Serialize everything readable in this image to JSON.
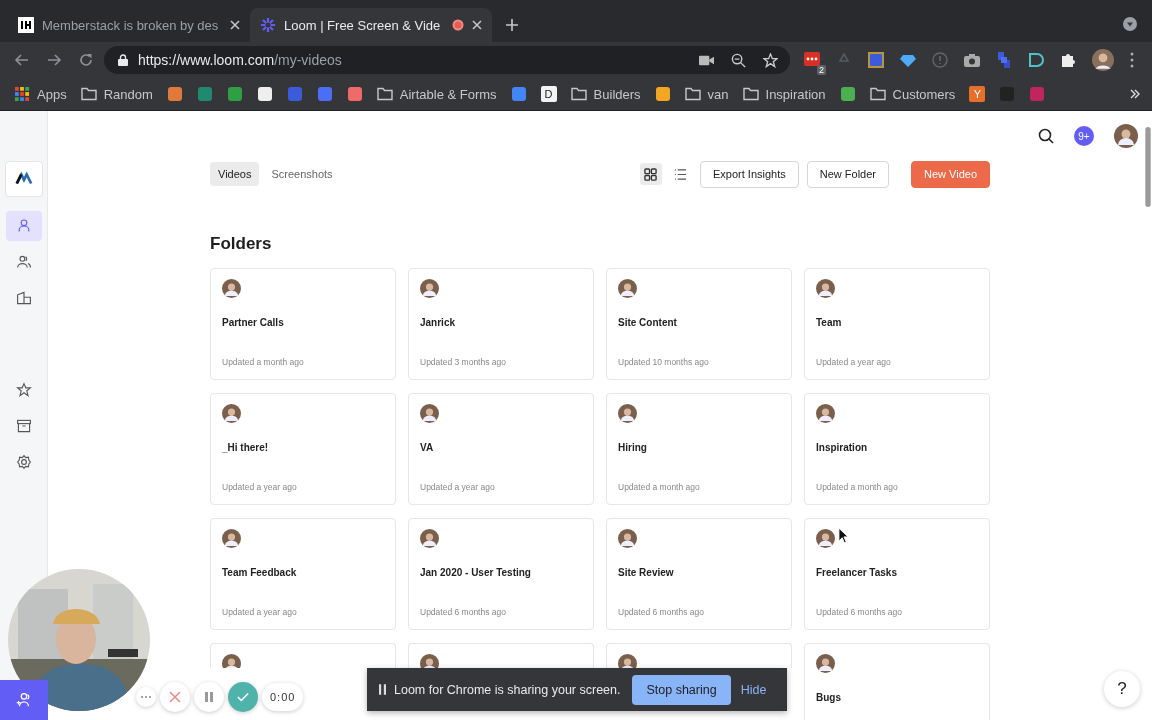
{
  "browser": {
    "tabs": [
      {
        "title": "Memberstack is broken by des",
        "kind": "ih",
        "selected": false,
        "recording": false
      },
      {
        "title": "Loom | Free Screen & Vide",
        "kind": "loom",
        "selected": true,
        "recording": true
      }
    ],
    "url_host": "https://www.loom.com",
    "url_path": "/my-videos",
    "extension_badge": "2",
    "bookmarks": [
      {
        "kind": "apps",
        "label": "Apps"
      },
      {
        "kind": "folder",
        "label": "Random"
      },
      {
        "kind": "icon"
      },
      {
        "kind": "icon"
      },
      {
        "kind": "icon"
      },
      {
        "kind": "icon"
      },
      {
        "kind": "icon"
      },
      {
        "kind": "icon"
      },
      {
        "kind": "icon"
      },
      {
        "kind": "folder",
        "label": "Airtable & Forms"
      },
      {
        "kind": "icon"
      },
      {
        "kind": "letter",
        "label": "D",
        "color": "#f1f3f4"
      },
      {
        "kind": "folder",
        "label": "Builders"
      },
      {
        "kind": "icon"
      },
      {
        "kind": "folder",
        "label": "van"
      },
      {
        "kind": "folder",
        "label": "Inspiration"
      },
      {
        "kind": "icon"
      },
      {
        "kind": "folder",
        "label": "Customers"
      },
      {
        "kind": "letter",
        "label": "Y",
        "color": "#e86f2a"
      },
      {
        "kind": "icon"
      },
      {
        "kind": "icon"
      }
    ]
  },
  "sidebar": {
    "items": [
      {
        "kind": "workspace",
        "selected": false
      },
      {
        "kind": "person",
        "selected": true
      },
      {
        "kind": "people",
        "selected": false
      },
      {
        "kind": "building",
        "selected": false
      },
      {
        "kind": "star",
        "selected": false
      },
      {
        "kind": "archive",
        "selected": false
      },
      {
        "kind": "settings",
        "selected": false
      }
    ]
  },
  "header": {
    "notifications": "9+"
  },
  "tabs": [
    {
      "label": "Videos",
      "selected": true
    },
    {
      "label": "Screenshots",
      "selected": false
    }
  ],
  "view_modes": [
    {
      "kind": "grid",
      "selected": true
    },
    {
      "kind": "list",
      "selected": false
    }
  ],
  "buttons": [
    {
      "label": "Export Insights",
      "kind": "secondary"
    },
    {
      "label": "New Folder",
      "kind": "secondary"
    },
    {
      "label": "New Video",
      "kind": "primary"
    }
  ],
  "folders_heading": "Folders",
  "folders": [
    {
      "title": "Partner Calls",
      "updated": "Updated a month ago"
    },
    {
      "title": "Janrick",
      "updated": "Updated 3 months ago"
    },
    {
      "title": "Site Content",
      "updated": "Updated 10 months ago"
    },
    {
      "title": "Team",
      "updated": "Updated a year ago"
    },
    {
      "title": "_Hi there!",
      "updated": "Updated a year ago"
    },
    {
      "title": "VA",
      "updated": "Updated a year ago"
    },
    {
      "title": "Hiring",
      "updated": "Updated a month ago"
    },
    {
      "title": "Inspiration",
      "updated": "Updated a month ago"
    },
    {
      "title": "Team Feedback",
      "updated": "Updated a year ago"
    },
    {
      "title": "Jan 2020 - User Testing",
      "updated": "Updated 6 months ago"
    },
    {
      "title": "Site Review",
      "updated": "Updated 6 months ago"
    },
    {
      "title": "Freelancer Tasks",
      "updated": "Updated 6 months ago"
    },
    {
      "kind": "covered"
    },
    {
      "kind": "covered"
    },
    {
      "kind": "covered"
    },
    {
      "title": "Bugs"
    }
  ],
  "recorder": {
    "timer": "0:00"
  },
  "sharing_bar": {
    "message": "Loom for Chrome is sharing your screen.",
    "stop": "Stop sharing",
    "hide": "Hide"
  },
  "help": "?"
}
